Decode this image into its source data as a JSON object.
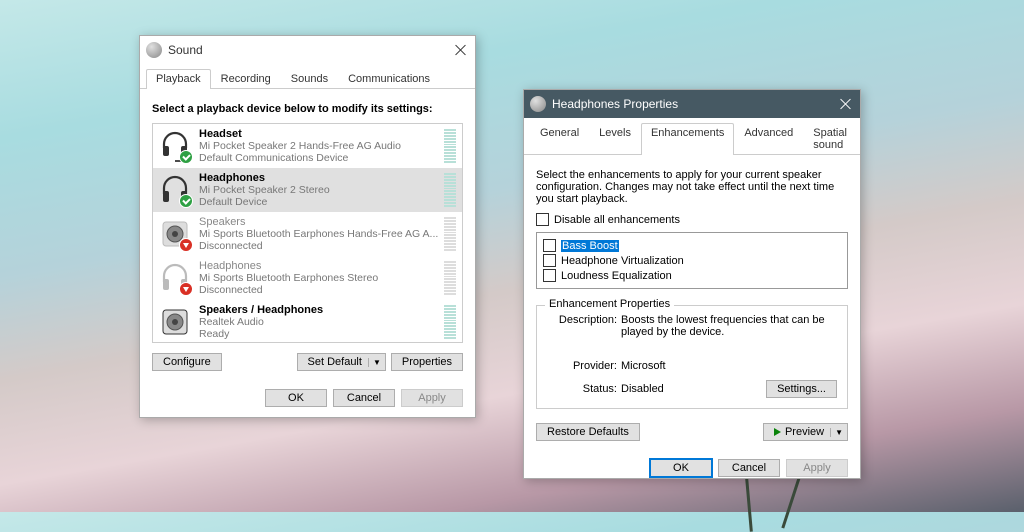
{
  "sound": {
    "title": "Sound",
    "tabs": [
      "Playback",
      "Recording",
      "Sounds",
      "Communications"
    ],
    "active_tab": 0,
    "instruction": "Select a playback device below to modify its settings:",
    "devices": [
      {
        "name": "Headset",
        "sub": "Mi Pocket Speaker 2 Hands-Free AG Audio",
        "status": "Default Communications Device",
        "icon": "headset",
        "badge": "green",
        "active": true
      },
      {
        "name": "Headphones",
        "sub": "Mi Pocket Speaker 2 Stereo",
        "status": "Default Device",
        "icon": "headphones",
        "badge": "green",
        "selected": true,
        "active": true
      },
      {
        "name": "Speakers",
        "sub": "Mi Sports Bluetooth Earphones Hands-Free AG A...",
        "status": "Disconnected",
        "icon": "speaker",
        "badge": "red",
        "active": false
      },
      {
        "name": "Headphones",
        "sub": "Mi Sports Bluetooth Earphones Stereo",
        "status": "Disconnected",
        "icon": "headphones",
        "badge": "red",
        "active": false
      },
      {
        "name": "Speakers / Headphones",
        "sub": "Realtek Audio",
        "status": "Ready",
        "icon": "speaker",
        "badge": "none",
        "active": true
      }
    ],
    "btn_configure": "Configure",
    "btn_setdefault": "Set Default",
    "btn_properties": "Properties",
    "btn_ok": "OK",
    "btn_cancel": "Cancel",
    "btn_apply": "Apply"
  },
  "props": {
    "title": "Headphones Properties",
    "tabs": [
      "General",
      "Levels",
      "Enhancements",
      "Advanced",
      "Spatial sound"
    ],
    "active_tab": 2,
    "instruction": "Select the enhancements to apply for your current speaker configuration. Changes may not take effect until the next time you start playback.",
    "disable_all_label": "Disable all enhancements",
    "enhancements": [
      "Bass Boost",
      "Headphone Virtualization",
      "Loudness Equalization"
    ],
    "selected_enh": 0,
    "fieldset_label": "Enhancement Properties",
    "desc_label": "Description:",
    "desc_value": "Boosts the lowest frequencies that can be played by the device.",
    "provider_label": "Provider:",
    "provider_value": "Microsoft",
    "status_label": "Status:",
    "status_value": "Disabled",
    "btn_settings": "Settings...",
    "btn_restore": "Restore Defaults",
    "btn_preview": "Preview",
    "btn_ok": "OK",
    "btn_cancel": "Cancel",
    "btn_apply": "Apply"
  }
}
